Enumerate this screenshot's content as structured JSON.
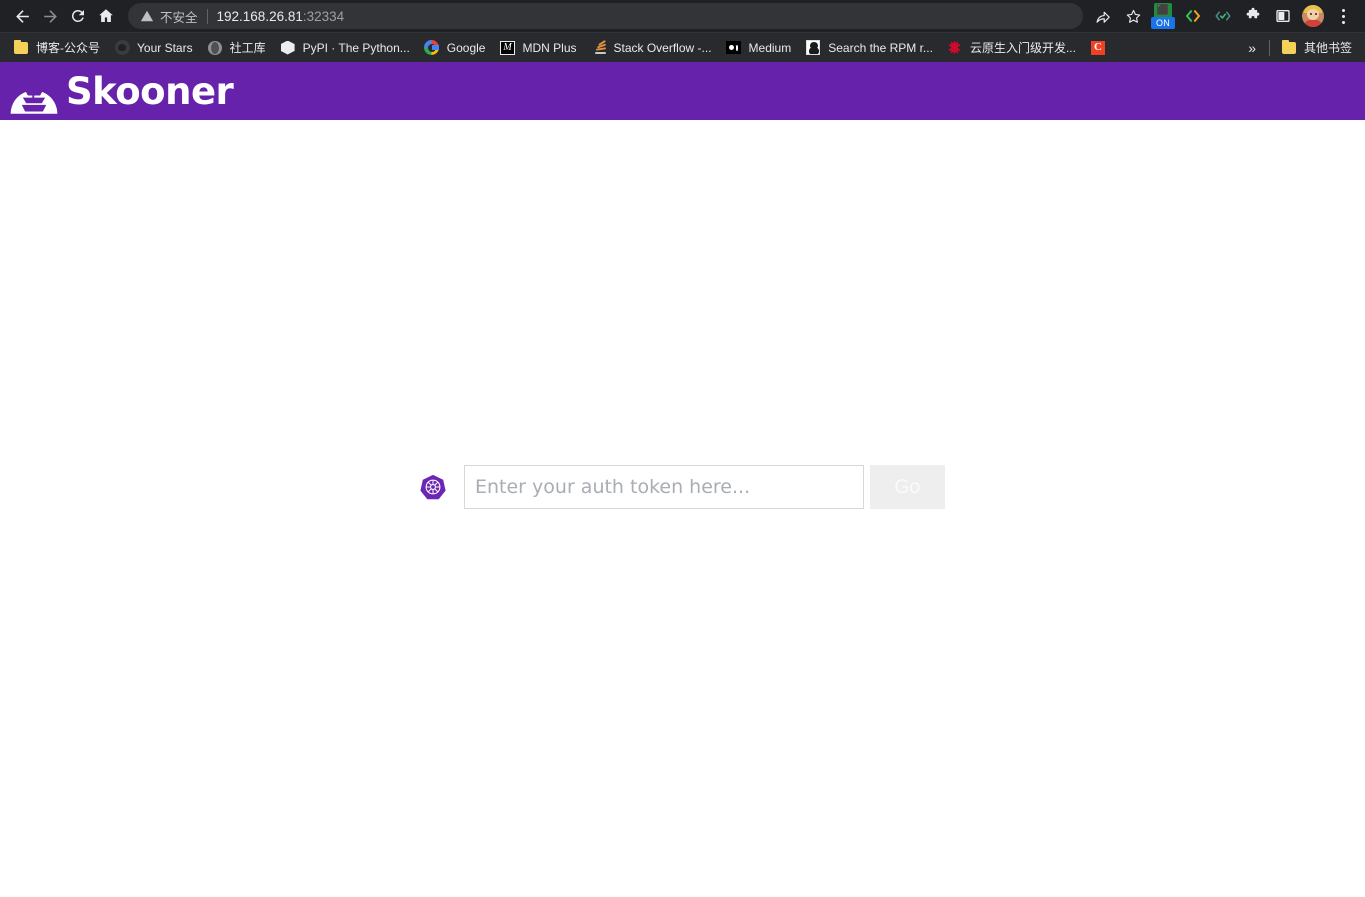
{
  "browser": {
    "nav": {
      "back_label": "Back",
      "forward_label": "Forward",
      "reload_label": "Reload",
      "home_label": "Home"
    },
    "omnibox": {
      "security_icon": "warning-triangle-icon",
      "security_text": "不安全",
      "url_host": "192.168.26.81",
      "url_port": ":32334"
    },
    "actions": [
      {
        "name": "share-icon",
        "label": "Share"
      },
      {
        "name": "bookmark-star-icon",
        "label": "Bookmark this tab"
      },
      {
        "name": "extension-on-icon",
        "label": "ON",
        "badge": "ON"
      },
      {
        "name": "code-brackets-icon",
        "label": "Code extension"
      },
      {
        "name": "check-brackets-icon",
        "label": "Validator extension"
      },
      {
        "name": "puzzle-piece-icon",
        "label": "Extensions"
      },
      {
        "name": "sidepanel-icon",
        "label": "Side panel"
      },
      {
        "name": "avatar-icon",
        "label": "Profile"
      },
      {
        "name": "kebab-menu-icon",
        "label": "Customize and control"
      }
    ],
    "bookmarks": [
      {
        "icon": "folder-icon",
        "label": "博客-公众号"
      },
      {
        "icon": "github-icon",
        "label": "Your Stars"
      },
      {
        "icon": "globe-icon",
        "label": "社工库"
      },
      {
        "icon": "cube-icon",
        "label": "PyPI · The Python..."
      },
      {
        "icon": "google-icon",
        "label": "Google"
      },
      {
        "icon": "mdn-icon",
        "label": "MDN Plus"
      },
      {
        "icon": "stackoverflow-icon",
        "label": "Stack Overflow -..."
      },
      {
        "icon": "medium-icon",
        "label": "Medium"
      },
      {
        "icon": "tux-penguin-icon",
        "label": "Search the RPM r..."
      },
      {
        "icon": "huawei-icon",
        "label": "云原生入门级开发..."
      },
      {
        "icon": "letter-c-icon",
        "label": ""
      }
    ],
    "bookmarks_overflow_label": "»",
    "other_bookmarks": {
      "icon": "folder-icon",
      "label": "其他书签"
    }
  },
  "page": {
    "header": {
      "logo_icon": "skooner-schooner-logo-icon",
      "title": "Skooner",
      "background_color": "#6622aa"
    },
    "auth": {
      "k8s_icon": "kubernetes-helm-icon",
      "token_placeholder": "Enter your auth token here...",
      "token_value": "",
      "go_label": "Go",
      "go_disabled": true
    }
  }
}
